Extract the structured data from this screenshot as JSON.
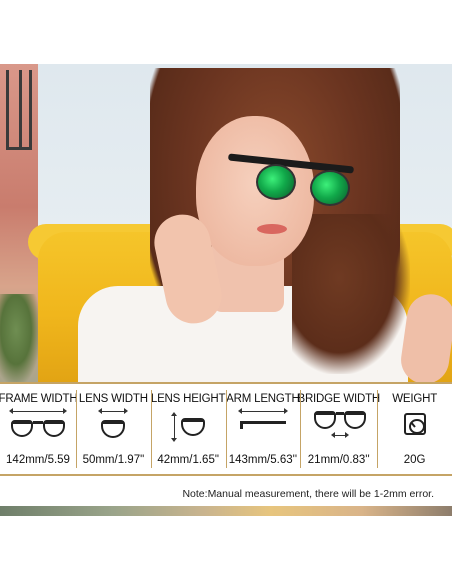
{
  "specs": [
    {
      "title": "FRAME WIDTH",
      "value": "142mm/5.59",
      "icon": "frame-width-icon"
    },
    {
      "title": "LENS WIDTH",
      "value": "50mm/1.97\"",
      "icon": "lens-width-icon"
    },
    {
      "title": "LENS HEIGHT",
      "value": "42mm/1.65\"",
      "icon": "lens-height-icon"
    },
    {
      "title": "ARM LENGTH",
      "value": "143mm/5.63''",
      "icon": "arm-length-icon"
    },
    {
      "title": "BRIDGE WIDTH",
      "value": "21mm/0.83''",
      "icon": "bridge-width-icon"
    },
    {
      "title": "WEIGHT",
      "value": "20G",
      "icon": "scale-icon"
    }
  ],
  "note": "Note:Manual measurement, there will be 1-2mm error.",
  "colors": {
    "accent_line": "#c5a466",
    "lens_green": "#11a94a",
    "chair_yellow": "#f0b61c"
  }
}
